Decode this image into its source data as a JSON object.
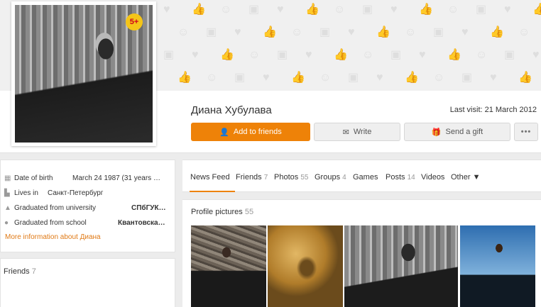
{
  "profile": {
    "name": "Диана Хубулава",
    "last_visit": "Last visit: 21 March 2012",
    "avatar_badge": "5+"
  },
  "actions": {
    "add_friends": "Add to friends",
    "write": "Write",
    "send_gift": "Send a gift",
    "more": "•••"
  },
  "info": {
    "birth_label": "Date of birth",
    "birth_value": "March 24 1987 (31 years …",
    "lives_label": "Lives in",
    "lives_value": "Санкт-Петербург",
    "university_label": "Graduated from university",
    "university_value": "СПбГУК…",
    "school_label": "Graduated from school",
    "school_value": "Квантовска…",
    "more_link": "More information about Диана"
  },
  "friends_card": {
    "label": "Friends",
    "count": "7"
  },
  "tabs": [
    {
      "label": "News Feed",
      "count": ""
    },
    {
      "label": "Friends",
      "count": "7"
    },
    {
      "label": "Photos",
      "count": "55"
    },
    {
      "label": "Groups",
      "count": "4"
    },
    {
      "label": "Games",
      "count": ""
    },
    {
      "label": "Posts",
      "count": "14"
    },
    {
      "label": "Videos",
      "count": ""
    },
    {
      "label": "Other ▼",
      "count": ""
    }
  ],
  "photos": {
    "title": "Profile pictures",
    "count": "55"
  },
  "colors": {
    "accent": "#ee8208",
    "badge": "#f5c518"
  },
  "icons": [
    "heart-icon",
    "like-icon",
    "smile-icon",
    "photo-icon",
    "user-plus-icon",
    "envelope-icon",
    "gift-icon",
    "calendar-icon",
    "building-icon",
    "graduation-icon",
    "school-icon"
  ]
}
